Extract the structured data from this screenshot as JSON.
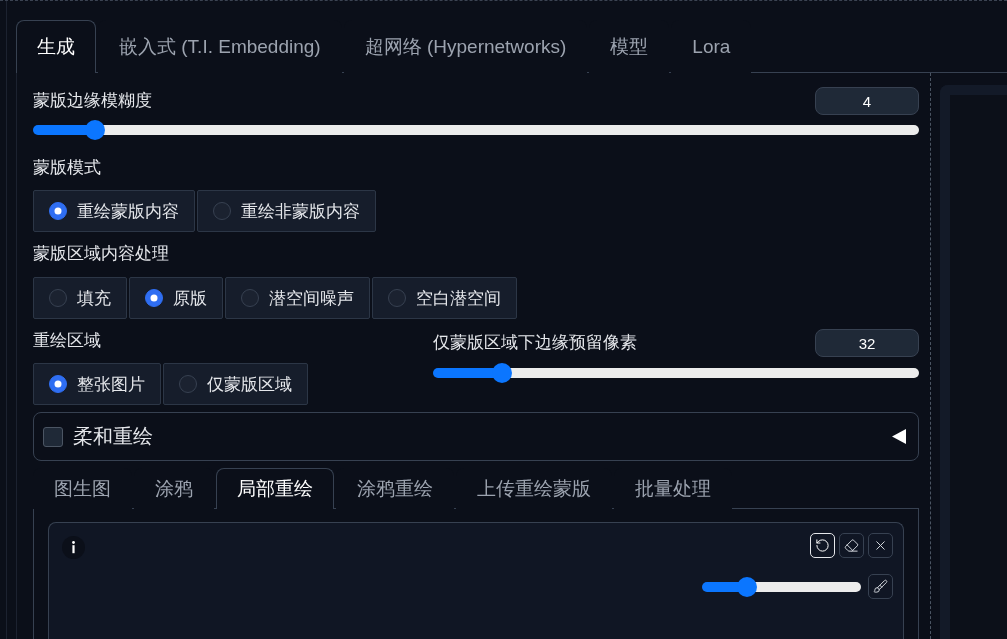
{
  "tabs": [
    {
      "label": "生成",
      "selected": true
    },
    {
      "label": "嵌入式 (T.I. Embedding)",
      "selected": false
    },
    {
      "label": "超网络 (Hypernetworks)",
      "selected": false
    },
    {
      "label": "模型",
      "selected": false
    },
    {
      "label": "Lora",
      "selected": false
    }
  ],
  "mask_blur": {
    "label": "蒙版边缘模糊度",
    "value": "4",
    "level": 0.07
  },
  "mask_mode": {
    "label": "蒙版模式",
    "options": [
      {
        "label": "重绘蒙版内容",
        "selected": true
      },
      {
        "label": "重绘非蒙版内容",
        "selected": false
      }
    ]
  },
  "masked_content": {
    "label": "蒙版区域内容处理",
    "options": [
      {
        "label": "填充",
        "selected": false
      },
      {
        "label": "原版",
        "selected": true
      },
      {
        "label": "潜空间噪声",
        "selected": false
      },
      {
        "label": "空白潜空间",
        "selected": false
      }
    ]
  },
  "inpaint_area": {
    "label": "重绘区域",
    "options": [
      {
        "label": "整张图片",
        "selected": true
      },
      {
        "label": "仅蒙版区域",
        "selected": false
      }
    ]
  },
  "mask_padding": {
    "label": "仅蒙版区域下边缘预留像素",
    "value": "32",
    "level": 0.142
  },
  "soft_inpainting": {
    "label": "柔和重绘",
    "checked": false,
    "expanded": false
  },
  "sub_tabs": [
    {
      "label": "图生图",
      "selected": false
    },
    {
      "label": "涂鸦",
      "selected": false
    },
    {
      "label": "局部重绘",
      "selected": true
    },
    {
      "label": "涂鸦重绘",
      "selected": false
    },
    {
      "label": "上传重绘蒙版",
      "selected": false
    },
    {
      "label": "批量处理",
      "selected": false
    }
  ],
  "image_editor": {
    "tools": [
      {
        "kind": "undo",
        "focused": true
      },
      {
        "kind": "eraser",
        "focused": false
      },
      {
        "kind": "close",
        "focused": false
      }
    ],
    "brush_size": {
      "level": 0.283
    },
    "brush_tools": [
      {
        "kind": "brush",
        "focused": false
      }
    ]
  }
}
